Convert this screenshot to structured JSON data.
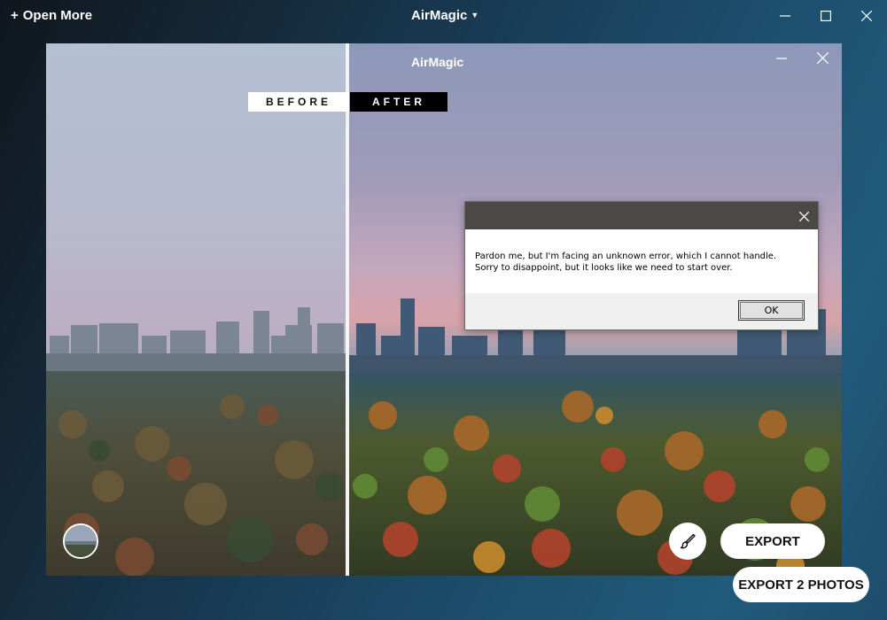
{
  "window": {
    "open_more_label": "Open More",
    "title": "AirMagic"
  },
  "viewer": {
    "title": "AirMagic",
    "before_label": "BEFORE",
    "after_label": "AFTER",
    "export_label": "EXPORT"
  },
  "footer": {
    "export_all_label": "EXPORT 2 PHOTOS"
  },
  "dialog": {
    "message_line1": "Pardon me, but I'm facing an unknown error, which I cannot handle.",
    "message_line2": "Sorry to disappoint, but it looks like we need to start over.",
    "ok_label": "OK"
  },
  "icons": {
    "plus": "plus-icon",
    "caret": "chevron-down-icon",
    "minimize": "minimize-icon",
    "maximize": "maximize-icon",
    "close": "close-icon",
    "brush": "brush-icon"
  },
  "colors": {
    "dialog_titlebar": "#4a4946",
    "dialog_background": "#f0f0f0",
    "button_white": "#ffffff"
  }
}
